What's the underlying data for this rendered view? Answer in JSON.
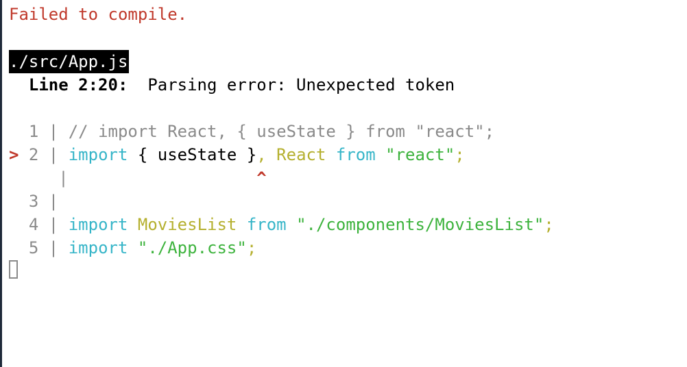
{
  "terminal": {
    "title": "Failed to compile.",
    "file": "./src/App.js",
    "error_location": "Line 2:20:",
    "error_message": "Parsing error: Unexpected token",
    "code_lines": [
      {
        "num": "1",
        "marker": " ",
        "parts": {
          "a": "// import React, { useState } from \"react\";"
        }
      },
      {
        "num": "2",
        "marker": ">",
        "parts": {
          "kw1": "import",
          "plain": " { useState }",
          "punct1": ",",
          "ident": " React",
          "kw2": " from",
          "str": " \"react\"",
          "punct2": ";"
        }
      },
      {
        "num": "",
        "marker": " ",
        "caret": "^"
      },
      {
        "num": "3",
        "marker": " "
      },
      {
        "num": "4",
        "marker": " ",
        "parts": {
          "kw1": "import",
          "ident": " MoviesList",
          "kw2": " from",
          "str": " \"./components/MoviesList\"",
          "punct": ";"
        }
      },
      {
        "num": "5",
        "marker": " ",
        "parts": {
          "kw1": "import",
          "str": " \"./App.css\"",
          "punct": ";"
        }
      }
    ]
  }
}
